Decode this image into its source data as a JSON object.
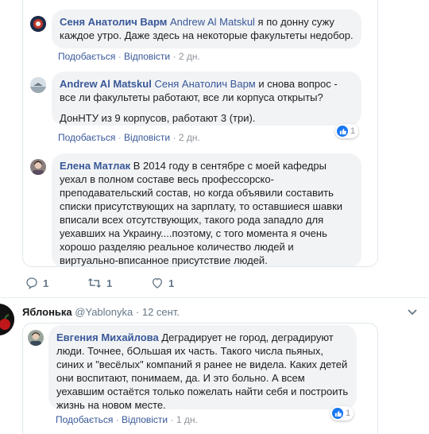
{
  "comments": [
    {
      "author": "Сеня Анатолич Варм",
      "mention": "Andrew Al Matskul",
      "text": " я по донну сужу каждое утро. Даже здесь на некоторые факультеты недобор.",
      "like": "Подобається",
      "reply": "Відповісти",
      "time": "2 дн."
    },
    {
      "author": "Andrew Al Matskul",
      "mention": "Сеня Анатолич Варм",
      "text": " и снова вопрос - все ли факультеты работают, все ли корпуса открыты?",
      "text2": "ДонНТУ из 9 корпусов, работают 3 (три).",
      "like": "Подобається",
      "reply": "Відповісти",
      "time": "2 дн.",
      "reactions": "1"
    },
    {
      "author": "Елена Матлак",
      "text": " В 2014 году в сентябре с моей кафедры уехал в полном составе весь профессорско-преподавательский состав, но когда объявили составить списки присутствующих на зарплату, то оставшиеся шавки вписали всех отсутствующих, такого рода западло для уехавших на Украину....поэтому, с того момента я очень хорошо разделяю реальное количество людей и виртуально-вписанное присутствие людей."
    }
  ],
  "tweet_actions": {
    "replies": "1",
    "retweets": "1",
    "likes": "1"
  },
  "tweet": {
    "user": "Яблонька",
    "handle": "@Yablonyka",
    "sep": "·",
    "date": "12 сент."
  },
  "comment4": {
    "author": "Евгения Михайлова",
    "text": " Деградирует не город, деградируют люди. Точнее, бОльшая их часть. Такого числа пьяных, синих и \"весёлых\" компаний я ранее не видела. Каких детей они воспитают, понимаем, да. И это больно. А всем уехавшим остаётся только пожелать найти себя и построить жизнь на новом месте.",
    "like": "Подобається",
    "reply": "Відповісти",
    "time": "1 дн.",
    "reactions": "1"
  },
  "colors": {
    "link": "#385898",
    "bubble": "#f2f3f5",
    "like_blue": "#1877f2",
    "meta": "#90949c"
  }
}
